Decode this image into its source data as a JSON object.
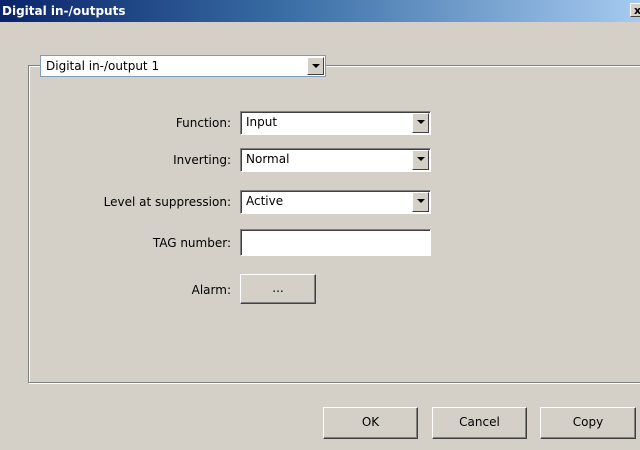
{
  "window": {
    "title": "Digital in-/outputs",
    "close_glyph": "x"
  },
  "group": {
    "selected": "Digital in-/output 1"
  },
  "form": {
    "function_label": "Function:",
    "function_value": "Input",
    "inverting_label": "Inverting:",
    "inverting_value": "Normal",
    "level_label": "Level at suppression:",
    "level_value": "Active",
    "tag_label": "TAG number:",
    "tag_value": "",
    "alarm_label": "Alarm:",
    "alarm_button": "..."
  },
  "buttons": {
    "ok": "OK",
    "cancel": "Cancel",
    "copy": "Copy"
  }
}
